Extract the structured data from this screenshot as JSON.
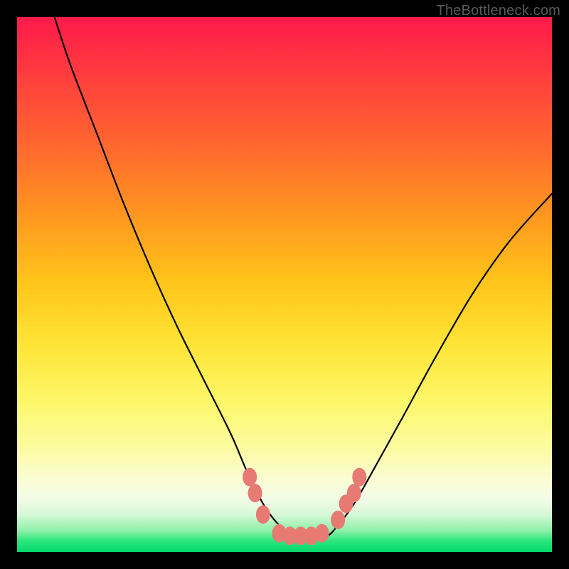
{
  "watermark": "TheBottleneck.com",
  "chart_data": {
    "type": "line",
    "title": "",
    "xlabel": "",
    "ylabel": "",
    "xlim": [
      0,
      100
    ],
    "ylim": [
      0,
      100
    ],
    "series": [
      {
        "name": "bottleneck-curve",
        "x": [
          7,
          10,
          15,
          20,
          25,
          30,
          35,
          40,
          43,
          46,
          49,
          52,
          55,
          58,
          60,
          63,
          67,
          72,
          78,
          85,
          92,
          100
        ],
        "y": [
          100,
          91,
          78,
          65,
          53,
          42,
          32,
          22,
          15,
          9,
          5,
          3,
          2.5,
          3,
          5,
          9,
          16,
          25,
          36,
          48,
          58,
          67
        ]
      }
    ],
    "markers": {
      "name": "highlight-dots",
      "color": "#e87a74",
      "points": [
        {
          "x": 43.5,
          "y": 14
        },
        {
          "x": 44.5,
          "y": 11
        },
        {
          "x": 46,
          "y": 7
        },
        {
          "x": 49,
          "y": 3.5
        },
        {
          "x": 51,
          "y": 3
        },
        {
          "x": 53,
          "y": 3
        },
        {
          "x": 55,
          "y": 3
        },
        {
          "x": 57,
          "y": 3.5
        },
        {
          "x": 60,
          "y": 6
        },
        {
          "x": 61.5,
          "y": 9
        },
        {
          "x": 63,
          "y": 11
        },
        {
          "x": 64,
          "y": 14
        }
      ]
    },
    "grid": false,
    "legend": false
  }
}
